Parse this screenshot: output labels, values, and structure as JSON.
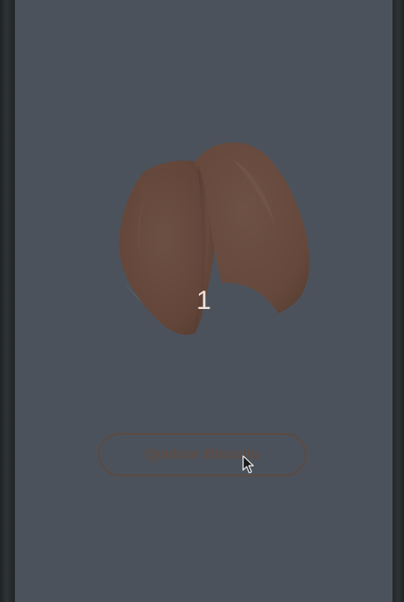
{
  "app": {
    "counter_value": "1",
    "break_button_label": "Quebrar Biscoito"
  },
  "icons": {
    "cookie": "fortune-cookie-icon",
    "cursor": "mouse-pointer-icon"
  },
  "colors": {
    "screen_background": "#4c525b",
    "cookie": "#6a4c40",
    "button_border": "#5b4a42",
    "button_text": "#5e4c44",
    "counter_text": "#f0e4de"
  }
}
